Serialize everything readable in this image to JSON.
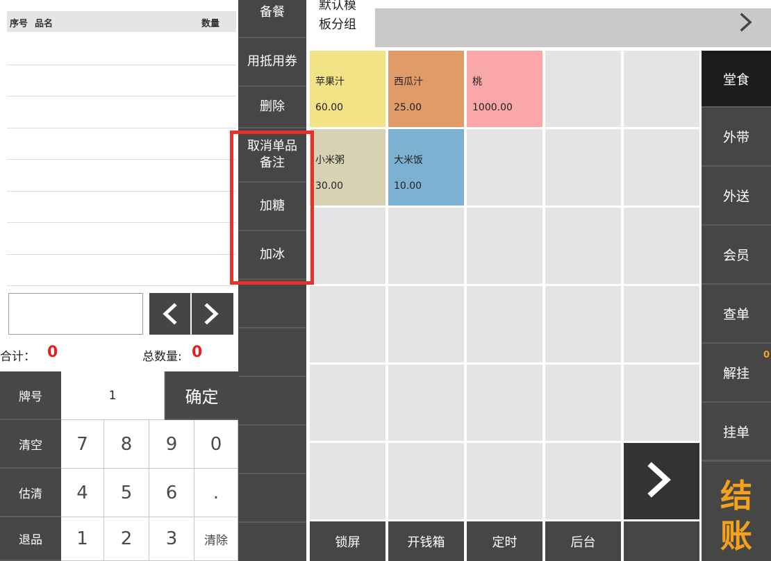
{
  "order_list": {
    "headers": {
      "seq": "序号",
      "name": "品名",
      "qty": "数量"
    },
    "rows": []
  },
  "entry": {
    "value": "",
    "prev_icon": "chevron-left-icon",
    "next_icon": "chevron-right-icon"
  },
  "totals": {
    "sum_label": "合计：",
    "sum_value": "0",
    "count_label": "总数量:",
    "count_value": "0",
    "value_color": "#e3231f"
  },
  "keypad": {
    "table_label": "牌号",
    "table_value": "1",
    "confirm_label": "确定",
    "rows": [
      {
        "action": "清空",
        "keys": [
          "7",
          "8",
          "9",
          "0"
        ]
      },
      {
        "action": "估清",
        "keys": [
          "4",
          "5",
          "6",
          "."
        ]
      },
      {
        "action": "退品",
        "keys": [
          "1",
          "2",
          "3",
          "清除"
        ]
      }
    ]
  },
  "remarks": {
    "items": [
      "备餐",
      "用抵用券",
      "删除",
      "取消单品备注",
      "加糖",
      "加冰"
    ]
  },
  "highlight": {
    "color": "#e6332a"
  },
  "category_tabs": {
    "active": "默认模板分组",
    "next_icon": "chevron-right-icon"
  },
  "product_grid": {
    "empty_color": "#e4e4e4",
    "rows": [
      [
        {
          "name": "苹果汁",
          "price": "60.00",
          "color": "#f1e386"
        },
        {
          "name": "西瓜汁",
          "price": "25.00",
          "color": "#e09b68"
        },
        {
          "name": "桃",
          "price": "1000.00",
          "color": "#f9a7a8"
        },
        null,
        null
      ],
      [
        {
          "name": "小米粥",
          "price": "30.00",
          "color": "#d8d2b5"
        },
        {
          "name": "大米饭",
          "price": "10.00",
          "color": "#7cb1d1"
        },
        null,
        null,
        null
      ],
      [
        null,
        null,
        null,
        null,
        null
      ],
      [
        null,
        null,
        null,
        null,
        null
      ],
      [
        null,
        null,
        null,
        null,
        null
      ],
      [
        null,
        null,
        null,
        null,
        {
          "kind": "next-page",
          "icon": "chevron-right-icon"
        }
      ]
    ]
  },
  "function_bar": {
    "items": [
      "锁屏",
      "开钱箱",
      "定时",
      "后台"
    ]
  },
  "order_modes": {
    "items": [
      "堂食",
      "外带",
      "外送",
      "会员",
      "查单",
      "解挂",
      "挂单"
    ],
    "selected": "堂食",
    "pending_badge": "0",
    "badge_color": "#f5a11c"
  },
  "checkout": {
    "label": "结账",
    "color": "#f5a11c"
  }
}
